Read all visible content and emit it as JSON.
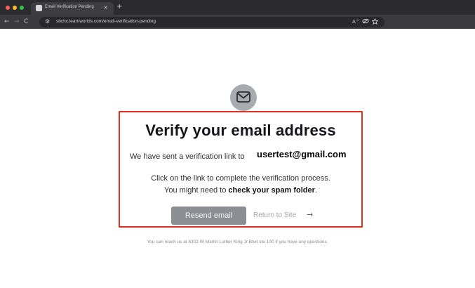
{
  "browser": {
    "tab_title": "Email Verification Pending",
    "tab_close": "×",
    "new_tab": "+",
    "nav_back": "←",
    "nav_forward": "→",
    "nav_reload": "C",
    "site_info": "⚙",
    "url": "sbchc.learnworlds.com/email-verification-pending",
    "omnibox_icons": [
      "translate-icon",
      "eye-off-icon",
      "star-icon"
    ]
  },
  "page": {
    "heading": "Verify your email address",
    "sent_text": "We have sent a verification link to",
    "email": "usertest@gmail.com",
    "instruction_line1": "Click on the link to complete the verification process.",
    "instruction_line2_prefix": "You might need to ",
    "instruction_line2_bold": "check your spam folder",
    "instruction_line2_suffix": ".",
    "resend_label": "Resend email",
    "return_label": "Return to Site",
    "return_arrow": "→",
    "footer": "You can reach us at 6302 W Martin Luther King Jr Blvd ste 100 if you have any questions."
  },
  "colors": {
    "highlight_border": "#e0301e",
    "resend_button": "#8b8e93",
    "badge": "#a8acb1"
  }
}
